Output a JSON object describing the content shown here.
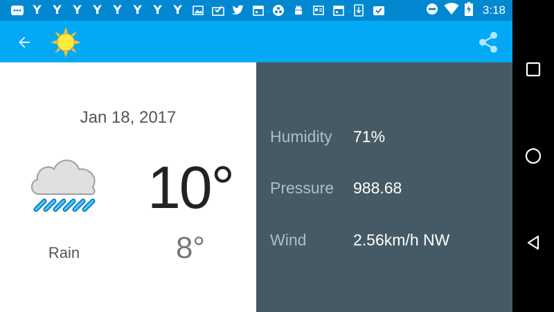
{
  "status_bar": {
    "time": "3:18",
    "left_icons": [
      "notification-icon",
      "y-icon",
      "y-icon",
      "y-icon",
      "y-icon",
      "y-icon",
      "y-icon",
      "y-icon",
      "y-icon",
      "image-icon",
      "check-mail-icon",
      "twitter-icon",
      "calendar-icon",
      "dots-icon",
      "android-icon",
      "newspaper-icon",
      "calendar-icon",
      "download-icon",
      "task-icon"
    ],
    "y_glyph": "Y",
    "right_icons": [
      "dnd-icon",
      "wifi-icon",
      "battery-charging-icon"
    ]
  },
  "app_bar": {
    "back_icon": "arrow-back-icon",
    "logo_icon": "sun-icon",
    "share_icon": "share-icon"
  },
  "weather": {
    "date": "Jan 18, 2017",
    "condition": "Rain",
    "condition_icon": "rain-cloud-icon",
    "high_temp": "10°",
    "low_temp": "8°"
  },
  "details": {
    "humidity_label": "Humidity",
    "humidity_value": "71%",
    "pressure_label": "Pressure",
    "pressure_value": "988.68",
    "wind_label": "Wind",
    "wind_value": "2.56km/h NW"
  },
  "nav_bar": {
    "recents_icon": "recents-icon",
    "home_icon": "home-icon",
    "back_icon": "nav-back-icon"
  },
  "colors": {
    "status_bar": "#0288d1",
    "app_bar": "#03a9f4",
    "details_panel": "#455a64",
    "detail_label": "#b0bec5"
  }
}
